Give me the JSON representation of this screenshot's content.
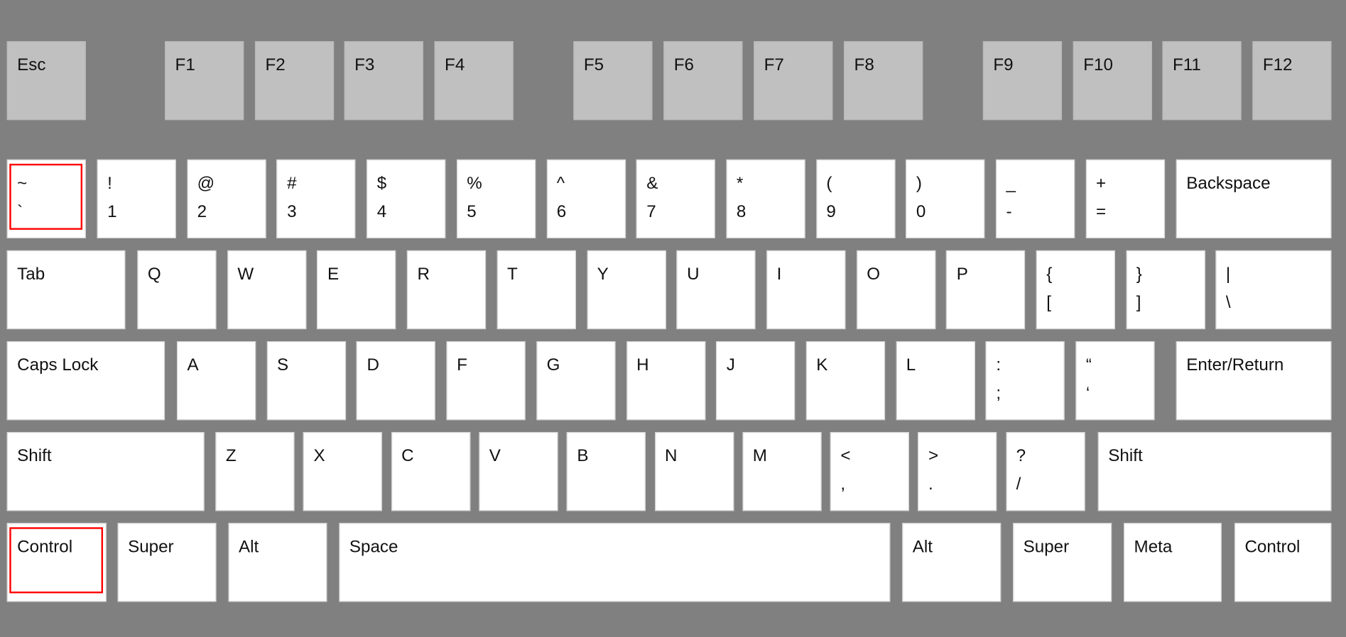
{
  "keyboard": {
    "rows": [
      [
        {
          "top": "Esc"
        },
        {
          "top": "F1"
        },
        {
          "top": "F2"
        },
        {
          "top": "F3"
        },
        {
          "top": "F4"
        },
        {
          "top": "F5"
        },
        {
          "top": "F6"
        },
        {
          "top": "F7"
        },
        {
          "top": "F8"
        },
        {
          "top": "F9"
        },
        {
          "top": "F10"
        },
        {
          "top": "F11"
        },
        {
          "top": "F12"
        }
      ],
      [
        {
          "top": "~",
          "bottom": "`"
        },
        {
          "top": "!",
          "bottom": "1"
        },
        {
          "top": "@",
          "bottom": "2"
        },
        {
          "top": "#",
          "bottom": "3"
        },
        {
          "top": "$",
          "bottom": "4"
        },
        {
          "top": "%",
          "bottom": "5"
        },
        {
          "top": "^",
          "bottom": "6"
        },
        {
          "top": "&",
          "bottom": "7"
        },
        {
          "top": "*",
          "bottom": "8"
        },
        {
          "top": "(",
          "bottom": "9"
        },
        {
          "top": ")",
          "bottom": "0"
        },
        {
          "top": "_",
          "bottom": "-"
        },
        {
          "top": "+",
          "bottom": "="
        },
        {
          "top": "Backspace"
        }
      ],
      [
        {
          "top": "Tab"
        },
        {
          "top": "Q"
        },
        {
          "top": "W"
        },
        {
          "top": "E"
        },
        {
          "top": "R"
        },
        {
          "top": "T"
        },
        {
          "top": "Y"
        },
        {
          "top": "U"
        },
        {
          "top": "I"
        },
        {
          "top": "O"
        },
        {
          "top": "P"
        },
        {
          "top": "{",
          "bottom": "["
        },
        {
          "top": "}",
          "bottom": "]"
        },
        {
          "top": "|",
          "bottom": "\\"
        }
      ],
      [
        {
          "top": "Caps Lock"
        },
        {
          "top": "A"
        },
        {
          "top": "S"
        },
        {
          "top": "D"
        },
        {
          "top": "F"
        },
        {
          "top": "G"
        },
        {
          "top": "H"
        },
        {
          "top": "J"
        },
        {
          "top": "K"
        },
        {
          "top": "L"
        },
        {
          "top": ":",
          "bottom": ";"
        },
        {
          "top": "“",
          "bottom": "‘"
        },
        {
          "top": "Enter/Return"
        }
      ],
      [
        {
          "top": "Shift"
        },
        {
          "top": "Z"
        },
        {
          "top": "X"
        },
        {
          "top": "C"
        },
        {
          "top": "V"
        },
        {
          "top": "B"
        },
        {
          "top": "N"
        },
        {
          "top": "M"
        },
        {
          "top": "<",
          "bottom": ","
        },
        {
          "top": ">",
          "bottom": "."
        },
        {
          "top": "?",
          "bottom": "/"
        },
        {
          "top": "Shift"
        }
      ],
      [
        {
          "top": "Control"
        },
        {
          "top": "Super"
        },
        {
          "top": "Alt"
        },
        {
          "top": "Space"
        },
        {
          "top": "Alt"
        },
        {
          "top": "Super"
        },
        {
          "top": "Meta"
        },
        {
          "top": "Control"
        }
      ]
    ],
    "highlighted": [
      [
        1,
        0
      ],
      [
        5,
        0
      ]
    ],
    "colors": {
      "background": "#808080",
      "function_key": "#c0c0c0",
      "key": "#ffffff",
      "highlight": "#ff0000"
    }
  }
}
